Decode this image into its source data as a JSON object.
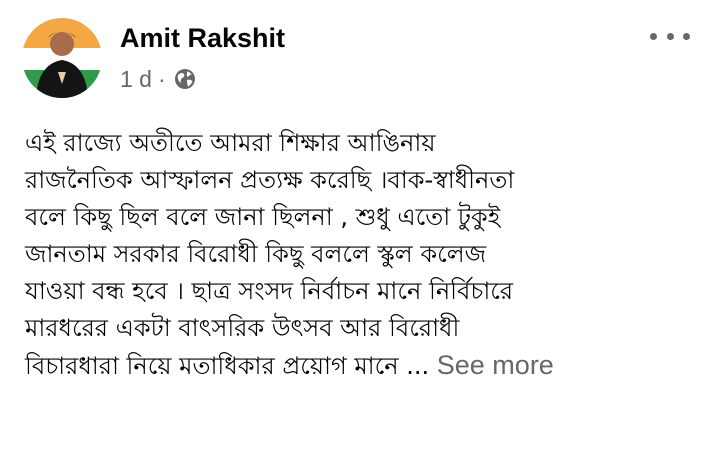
{
  "post": {
    "author": "Amit Rakshit",
    "timestamp": "1 d",
    "separator": "·",
    "audience_icon": "globe-icon",
    "more_icon": "more-options-icon",
    "lines": [
      "এই রাজ্যে অতীতে আমরা শিক্ষার আঙিনায়",
      "রাজনৈতিক আস্ফালন প্রত্যক্ষ করেছি ।বাক-স্বাধীনতা",
      "বলে কিছু ছিল বলে জানা ছিলনা , শুধু এতো টুকুই",
      "জানতাম সরকার বিরোধী কিছু বললে স্কুল কলেজ",
      "যাওয়া বন্ধ হবে । ছাত্র সংসদ নির্বাচন মানে নির্বিচারে",
      "মারধরের একটা বাৎসরিক উৎসব আর বিরোধী",
      "বিচারধারা নিয়ে মতাধিকার প্রয়োগ মানে ..."
    ],
    "see_more_label": "See more"
  },
  "colors": {
    "text": "#050505",
    "secondary": "#65676b",
    "background": "#ffffff"
  }
}
